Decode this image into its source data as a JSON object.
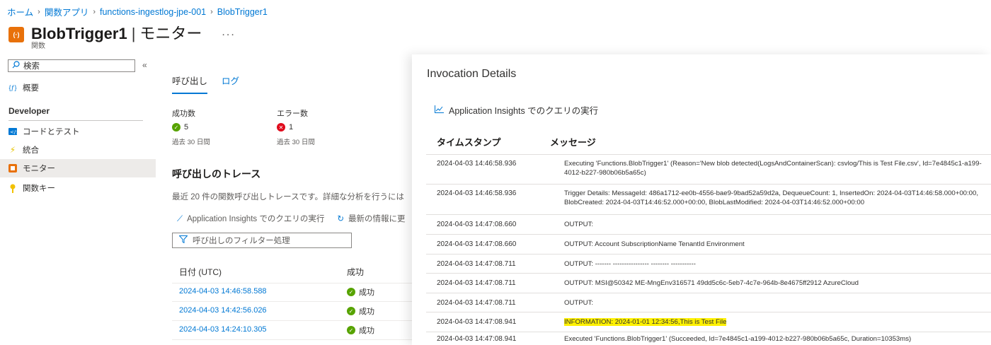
{
  "breadcrumb": [
    "ホーム",
    "関数アプリ",
    "functions-ingestlog-jpe-001",
    "BlobTrigger1"
  ],
  "header": {
    "title": "BlobTrigger1",
    "subtitle_suffix": "モニター",
    "more": "...",
    "type_label": "関数",
    "icon_text": "(·)"
  },
  "sidebar": {
    "search_placeholder": "検索",
    "collapse_icon": "«",
    "items_top": [
      {
        "label": "概要",
        "icon": "function-icon"
      }
    ],
    "section_header": "Developer",
    "items": [
      {
        "label": "コードとテスト",
        "icon": "code-icon"
      },
      {
        "label": "統合",
        "icon": "lightning-icon"
      },
      {
        "label": "モニター",
        "icon": "monitor-icon",
        "active": true
      },
      {
        "label": "関数キー",
        "icon": "key-icon"
      }
    ]
  },
  "main": {
    "tabs": [
      "呼び出し",
      "ログ"
    ],
    "stats": [
      {
        "label": "成功数",
        "value": "5",
        "period": "過去 30 日間",
        "status": "success"
      },
      {
        "label": "エラー数",
        "value": "1",
        "period": "過去 30 日間",
        "status": "error"
      }
    ],
    "section_title": "呼び出しのトレース",
    "description": "最近 20 件の関数呼び出しトレースです。詳細な分析を行うには",
    "actions": [
      "Application Insights でのクエリの実行",
      "最新の情報に更"
    ],
    "filter_placeholder": "呼び出しのフィルター処理",
    "columns": [
      "日付 (UTC)",
      "成功"
    ],
    "rows": [
      {
        "date": "2024-04-03 14:46:58.588",
        "status": "成功"
      },
      {
        "date": "2024-04-03 14:42:56.026",
        "status": "成功"
      },
      {
        "date": "2024-04-03 14:24:10.305",
        "status": "成功"
      }
    ]
  },
  "panel": {
    "title": "Invocation Details",
    "ai_link": "Application Insights でのクエリの実行",
    "columns": [
      "タイムスタンプ",
      "メッセージ"
    ],
    "rows": [
      {
        "ts": "2024-04-03 14:46:58.936",
        "msg": "Executing 'Functions.BlobTrigger1' (Reason='New blob detected(LogsAndContainerScan): csvlog/This is Test File.csv', Id=7e4845c1-a199-4012-b227-980b06b5a65c)"
      },
      {
        "ts": "2024-04-03 14:46:58.936",
        "msg": "Trigger Details: MessageId: 486a1712-ee0b-4556-bae9-9bad52a59d2a, DequeueCount: 1, InsertedOn: 2024-04-03T14:46:58.000+00:00, BlobCreated: 2024-04-03T14:46:52.000+00:00, BlobLastModified: 2024-04-03T14:46:52.000+00:00"
      },
      {
        "ts": "2024-04-03 14:47:08.660",
        "msg": "OUTPUT:"
      },
      {
        "ts": "2024-04-03 14:47:08.660",
        "msg": "OUTPUT: Account SubscriptionName TenantId Environment"
      },
      {
        "ts": "2024-04-03 14:47:08.711",
        "msg": "OUTPUT: ------- ---------------- -------- -----------"
      },
      {
        "ts": "2024-04-03 14:47:08.711",
        "msg": "OUTPUT: MSI@50342 ME-MngEnv316571 49dd5c6c-5eb7-4c7e-964b-8e4675ff2912 AzureCloud"
      },
      {
        "ts": "2024-04-03 14:47:08.711",
        "msg": "OUTPUT:"
      },
      {
        "ts": "2024-04-03 14:47:08.941",
        "msg": "INFORMATION: 2024-01-01 12:34:56,This is Test File",
        "highlight": true
      },
      {
        "ts": "2024-04-03 14:47:08.941",
        "msg": "Executed 'Functions.BlobTrigger1' (Succeeded, Id=7e4845c1-a199-4012-b227-980b06b5a65c, Duration=10353ms)"
      }
    ]
  },
  "colors": {
    "accent": "#0078d4",
    "success": "#57a300",
    "error": "#e00b1c",
    "highlight": "#fff100",
    "function_icon": "#e8710a"
  }
}
